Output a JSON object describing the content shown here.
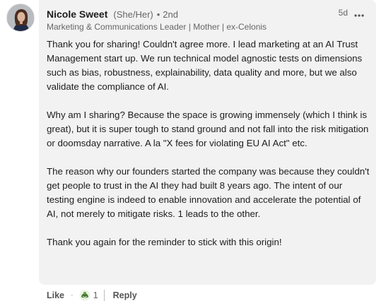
{
  "comment": {
    "author": {
      "name": "Nicole Sweet",
      "pronouns": "(She/Her)",
      "separator": "•",
      "degree": "2nd",
      "headline": "Marketing & Communications Leader | Mother | ex-Celonis"
    },
    "time": "5d",
    "paragraphs": [
      "Thank you for sharing! Couldn't agree more. I lead marketing at an AI Trust Management start up. We run technical model agnostic tests on dimensions such as bias, robustness, explainability, data quality and more, but we also validate the compliance of AI.",
      "Why am I sharing? Because the space is growing immensely (which I think is great), but it is super tough to stand ground and not fall into the risk mitigation or doomsday narrative. A la \"X fees for violating EU AI Act\" etc.",
      "The reason why our founders started the company was because they couldn't get people to trust in the AI they had built 8 years ago. The intent of our testing engine is indeed to enable innovation and accelerate the potential of AI, not merely to mitigate risks. 1 leads to the other.",
      "Thank you again for the reminder to stick with this origin!"
    ]
  },
  "actions": {
    "like_label": "Like",
    "separator": "·",
    "reaction_count": "1",
    "reply_label": "Reply"
  },
  "icons": {
    "more": "more-horizontal-icon",
    "reaction": "support-reaction-icon"
  },
  "colors": {
    "bubble_background": "#f2f2f2",
    "reaction_green": "#44712e"
  }
}
